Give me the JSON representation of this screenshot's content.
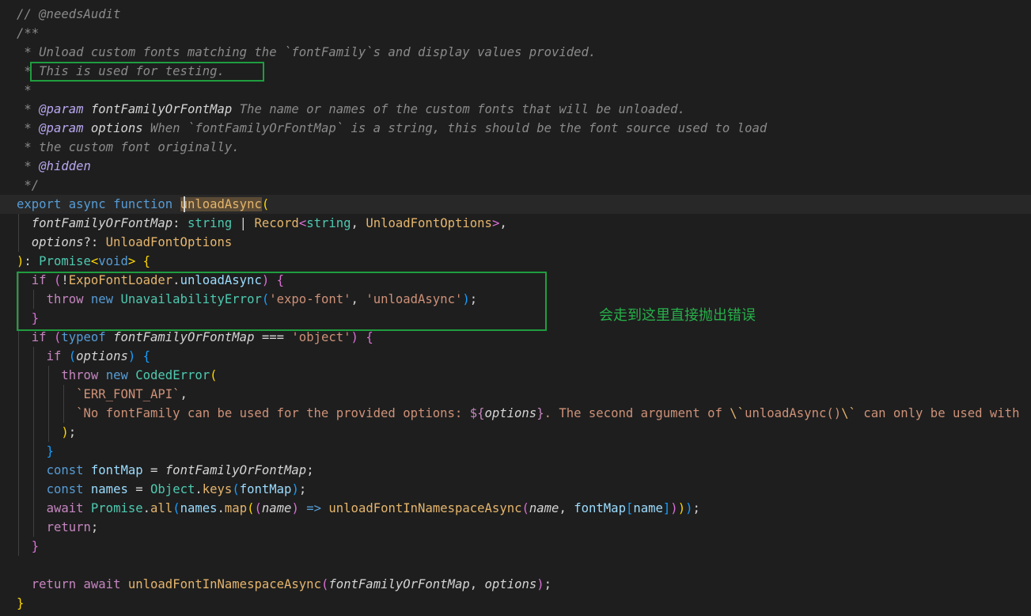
{
  "editor": {
    "lines": [
      [
        {
          "t": "// @needsAudit",
          "c": "cm"
        }
      ],
      [
        {
          "t": "/**",
          "c": "cm"
        }
      ],
      [
        {
          "t": " * Unload custom fonts matching the `fontFamily`s and display values provided.",
          "c": "cm"
        }
      ],
      [
        {
          "t": " * This is used for testing.",
          "c": "cm"
        }
      ],
      [
        {
          "t": " *",
          "c": "cm"
        }
      ],
      [
        {
          "t": " * ",
          "c": "cm"
        },
        {
          "t": "@param",
          "c": "tg i"
        },
        {
          "t": " fontFamilyOrFontMap",
          "c": "plain i"
        },
        {
          "t": " The name or names of the custom fonts that will be unloaded.",
          "c": "cm"
        }
      ],
      [
        {
          "t": " * ",
          "c": "cm"
        },
        {
          "t": "@param",
          "c": "tg i"
        },
        {
          "t": " options",
          "c": "plain i"
        },
        {
          "t": " When `fontFamilyOrFontMap` is a string, this should be the font source used to load",
          "c": "cm"
        }
      ],
      [
        {
          "t": " * the custom font originally.",
          "c": "cm"
        }
      ],
      [
        {
          "t": " * ",
          "c": "cm"
        },
        {
          "t": "@hidden",
          "c": "tg i"
        }
      ],
      [
        {
          "t": " */",
          "c": "cm"
        }
      ],
      [
        {
          "t": "export",
          "c": "kw"
        },
        {
          "t": " ",
          "c": "pu"
        },
        {
          "t": "async",
          "c": "kw"
        },
        {
          "t": " ",
          "c": "pu"
        },
        {
          "t": "function",
          "c": "kw"
        },
        {
          "t": " ",
          "c": "pu"
        },
        {
          "t": "unloadAsync",
          "c": "fn hl-word"
        },
        {
          "t": "(",
          "c": "br1"
        }
      ],
      [
        {
          "t": "  ",
          "c": "pu"
        },
        {
          "t": "fontFamilyOrFontMap",
          "c": "plain i"
        },
        {
          "t": ": ",
          "c": "pu"
        },
        {
          "t": "string",
          "c": "ty"
        },
        {
          "t": " | ",
          "c": "pu"
        },
        {
          "t": "Record",
          "c": "fn"
        },
        {
          "t": "<",
          "c": "br2"
        },
        {
          "t": "string",
          "c": "ty"
        },
        {
          "t": ", ",
          "c": "pu"
        },
        {
          "t": "UnloadFontOptions",
          "c": "fn"
        },
        {
          "t": ">",
          "c": "br2"
        },
        {
          "t": ",",
          "c": "pu"
        }
      ],
      [
        {
          "t": "  ",
          "c": "pu"
        },
        {
          "t": "options",
          "c": "plain i"
        },
        {
          "t": "?: ",
          "c": "pu"
        },
        {
          "t": "UnloadFontOptions",
          "c": "fn"
        }
      ],
      [
        {
          "t": ")",
          "c": "br1"
        },
        {
          "t": ": ",
          "c": "pu"
        },
        {
          "t": "Promise",
          "c": "ty"
        },
        {
          "t": "<",
          "c": "br1"
        },
        {
          "t": "void",
          "c": "kw"
        },
        {
          "t": ">",
          "c": "br1"
        },
        {
          "t": " ",
          "c": "pu"
        },
        {
          "t": "{",
          "c": "br1"
        }
      ],
      [
        {
          "t": "  ",
          "c": "pu"
        },
        {
          "t": "if",
          "c": "ctl"
        },
        {
          "t": " ",
          "c": "pu"
        },
        {
          "t": "(",
          "c": "br2"
        },
        {
          "t": "!",
          "c": "pu"
        },
        {
          "t": "ExpoFontLoader",
          "c": "fn"
        },
        {
          "t": ".",
          "c": "pu"
        },
        {
          "t": "unloadAsync",
          "c": "var"
        },
        {
          "t": ")",
          "c": "br2"
        },
        {
          "t": " ",
          "c": "pu"
        },
        {
          "t": "{",
          "c": "br2"
        }
      ],
      [
        {
          "t": "    ",
          "c": "pu"
        },
        {
          "t": "throw",
          "c": "ctl"
        },
        {
          "t": " ",
          "c": "pu"
        },
        {
          "t": "new",
          "c": "kw"
        },
        {
          "t": " ",
          "c": "pu"
        },
        {
          "t": "UnavailabilityError",
          "c": "ty"
        },
        {
          "t": "(",
          "c": "br3"
        },
        {
          "t": "'expo-font'",
          "c": "str"
        },
        {
          "t": ", ",
          "c": "pu"
        },
        {
          "t": "'unloadAsync'",
          "c": "str"
        },
        {
          "t": ")",
          "c": "br3"
        },
        {
          "t": ";",
          "c": "pu"
        }
      ],
      [
        {
          "t": "  ",
          "c": "pu"
        },
        {
          "t": "}",
          "c": "br2"
        }
      ],
      [
        {
          "t": "  ",
          "c": "pu"
        },
        {
          "t": "if",
          "c": "ctl"
        },
        {
          "t": " ",
          "c": "pu"
        },
        {
          "t": "(",
          "c": "br2"
        },
        {
          "t": "typeof",
          "c": "kw"
        },
        {
          "t": " ",
          "c": "pu"
        },
        {
          "t": "fontFamilyOrFontMap",
          "c": "plain i"
        },
        {
          "t": " === ",
          "c": "pu"
        },
        {
          "t": "'object'",
          "c": "str"
        },
        {
          "t": ")",
          "c": "br2"
        },
        {
          "t": " ",
          "c": "pu"
        },
        {
          "t": "{",
          "c": "br2"
        }
      ],
      [
        {
          "t": "    ",
          "c": "pu"
        },
        {
          "t": "if",
          "c": "ctl"
        },
        {
          "t": " ",
          "c": "pu"
        },
        {
          "t": "(",
          "c": "br3"
        },
        {
          "t": "options",
          "c": "plain i"
        },
        {
          "t": ")",
          "c": "br3"
        },
        {
          "t": " ",
          "c": "pu"
        },
        {
          "t": "{",
          "c": "br3"
        }
      ],
      [
        {
          "t": "      ",
          "c": "pu"
        },
        {
          "t": "throw",
          "c": "ctl"
        },
        {
          "t": " ",
          "c": "pu"
        },
        {
          "t": "new",
          "c": "kw"
        },
        {
          "t": " ",
          "c": "pu"
        },
        {
          "t": "CodedError",
          "c": "ty"
        },
        {
          "t": "(",
          "c": "br1"
        }
      ],
      [
        {
          "t": "        ",
          "c": "pu"
        },
        {
          "t": "`ERR_FONT_API`",
          "c": "str"
        },
        {
          "t": ",",
          "c": "pu"
        }
      ],
      [
        {
          "t": "        ",
          "c": "pu"
        },
        {
          "t": "`No fontFamily can be used for the provided options: ",
          "c": "str"
        },
        {
          "t": "${",
          "c": "ctl"
        },
        {
          "t": "options",
          "c": "plain i"
        },
        {
          "t": "}",
          "c": "ctl"
        },
        {
          "t": ". The second argument of ",
          "c": "str"
        },
        {
          "t": "\\`",
          "c": "fn"
        },
        {
          "t": "unloadAsync()",
          "c": "str"
        },
        {
          "t": "\\`",
          "c": "fn"
        },
        {
          "t": " can only be used with",
          "c": "str"
        }
      ],
      [
        {
          "t": "      ",
          "c": "pu"
        },
        {
          "t": ")",
          "c": "br1"
        },
        {
          "t": ";",
          "c": "pu"
        }
      ],
      [
        {
          "t": "    ",
          "c": "pu"
        },
        {
          "t": "}",
          "c": "br3"
        }
      ],
      [
        {
          "t": "    ",
          "c": "pu"
        },
        {
          "t": "const",
          "c": "kw"
        },
        {
          "t": " ",
          "c": "pu"
        },
        {
          "t": "fontMap",
          "c": "var"
        },
        {
          "t": " = ",
          "c": "pu"
        },
        {
          "t": "fontFamilyOrFontMap",
          "c": "plain i"
        },
        {
          "t": ";",
          "c": "pu"
        }
      ],
      [
        {
          "t": "    ",
          "c": "pu"
        },
        {
          "t": "const",
          "c": "kw"
        },
        {
          "t": " ",
          "c": "pu"
        },
        {
          "t": "names",
          "c": "var"
        },
        {
          "t": " = ",
          "c": "pu"
        },
        {
          "t": "Object",
          "c": "ty"
        },
        {
          "t": ".",
          "c": "pu"
        },
        {
          "t": "keys",
          "c": "fn"
        },
        {
          "t": "(",
          "c": "br3"
        },
        {
          "t": "fontMap",
          "c": "var"
        },
        {
          "t": ")",
          "c": "br3"
        },
        {
          "t": ";",
          "c": "pu"
        }
      ],
      [
        {
          "t": "    ",
          "c": "pu"
        },
        {
          "t": "await",
          "c": "ctl"
        },
        {
          "t": " ",
          "c": "pu"
        },
        {
          "t": "Promise",
          "c": "ty"
        },
        {
          "t": ".",
          "c": "pu"
        },
        {
          "t": "all",
          "c": "fn"
        },
        {
          "t": "(",
          "c": "br3"
        },
        {
          "t": "names",
          "c": "var"
        },
        {
          "t": ".",
          "c": "pu"
        },
        {
          "t": "map",
          "c": "fn"
        },
        {
          "t": "(",
          "c": "br1"
        },
        {
          "t": "(",
          "c": "br2"
        },
        {
          "t": "name",
          "c": "plain i"
        },
        {
          "t": ")",
          "c": "br2"
        },
        {
          "t": " => ",
          "c": "kw"
        },
        {
          "t": "unloadFontInNamespaceAsync",
          "c": "fn"
        },
        {
          "t": "(",
          "c": "br2"
        },
        {
          "t": "name",
          "c": "plain i"
        },
        {
          "t": ", ",
          "c": "pu"
        },
        {
          "t": "fontMap",
          "c": "var"
        },
        {
          "t": "[",
          "c": "br3"
        },
        {
          "t": "name",
          "c": "var"
        },
        {
          "t": "]",
          "c": "br3"
        },
        {
          "t": ")",
          "c": "br2"
        },
        {
          "t": ")",
          "c": "br1"
        },
        {
          "t": ")",
          "c": "br3"
        },
        {
          "t": ";",
          "c": "pu"
        }
      ],
      [
        {
          "t": "    ",
          "c": "pu"
        },
        {
          "t": "return",
          "c": "ctl"
        },
        {
          "t": ";",
          "c": "pu"
        }
      ],
      [
        {
          "t": "  ",
          "c": "pu"
        },
        {
          "t": "}",
          "c": "br2"
        }
      ],
      [
        {
          "t": "",
          "c": "pu"
        }
      ],
      [
        {
          "t": "  ",
          "c": "pu"
        },
        {
          "t": "return",
          "c": "ctl"
        },
        {
          "t": " ",
          "c": "pu"
        },
        {
          "t": "await",
          "c": "ctl"
        },
        {
          "t": " ",
          "c": "pu"
        },
        {
          "t": "unloadFontInNamespaceAsync",
          "c": "fn"
        },
        {
          "t": "(",
          "c": "br2"
        },
        {
          "t": "fontFamilyOrFontMap",
          "c": "plain i"
        },
        {
          "t": ", ",
          "c": "pu"
        },
        {
          "t": "options",
          "c": "plain i"
        },
        {
          "t": ")",
          "c": "br2"
        },
        {
          "t": ";",
          "c": "pu"
        }
      ],
      [
        {
          "t": "}",
          "c": "br1"
        }
      ]
    ]
  },
  "annotation": {
    "note": "会走到这里直接抛出错误"
  }
}
